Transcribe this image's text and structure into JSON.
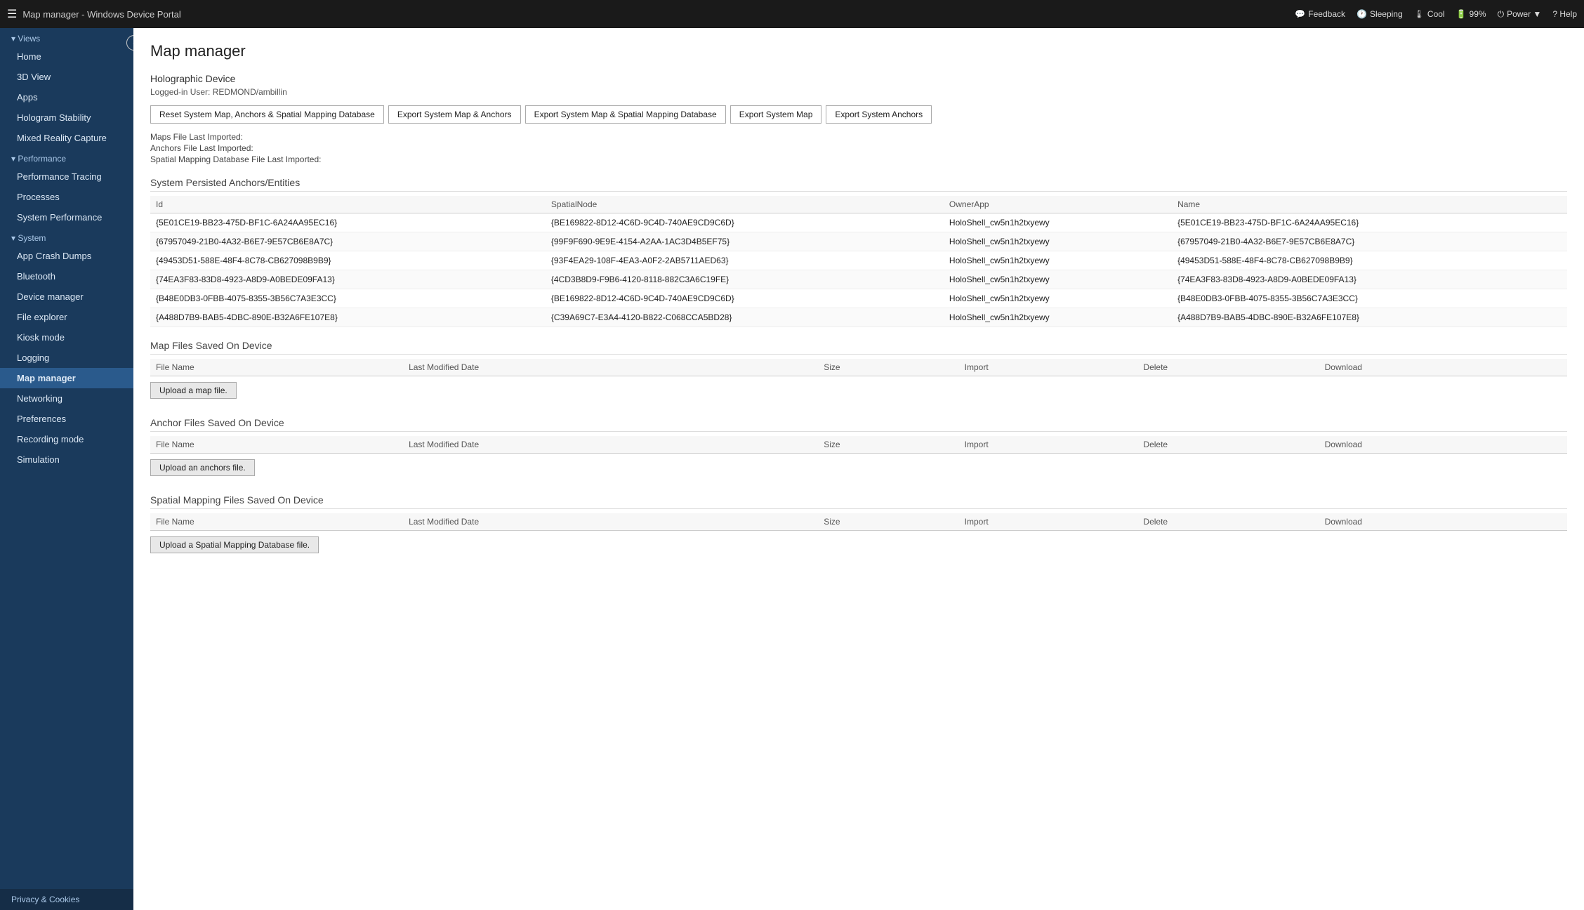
{
  "topbar": {
    "title": "Map manager - Windows Device Portal",
    "hamburger_icon": "☰",
    "items": [
      {
        "label": "Feedback",
        "icon": "💬"
      },
      {
        "label": "Sleeping",
        "icon": "🕐"
      },
      {
        "label": "Cool",
        "icon": "🌡"
      },
      {
        "label": "99%",
        "icon": "🔋"
      },
      {
        "label": "Power ▼",
        "icon": "⏻"
      },
      {
        "label": "? Help",
        "icon": ""
      }
    ]
  },
  "sidebar": {
    "collapse_icon": "‹",
    "sections": [
      {
        "header": "Views",
        "items": [
          "Home",
          "3D View",
          "Apps",
          "Hologram Stability",
          "Mixed Reality Capture"
        ]
      },
      {
        "header": "Performance",
        "items": [
          "Performance Tracing",
          "Processes",
          "System Performance"
        ]
      },
      {
        "header": "System",
        "items": [
          "App Crash Dumps",
          "Bluetooth",
          "Device manager",
          "File explorer",
          "Kiosk mode",
          "Logging",
          "Map manager",
          "Networking",
          "Preferences",
          "Recording mode",
          "Simulation"
        ]
      }
    ],
    "footer": "Privacy & Cookies"
  },
  "page": {
    "title": "Map manager",
    "device": {
      "name": "Holographic Device",
      "user_label": "Logged-in User:",
      "user": "REDMOND/ambillin"
    },
    "buttons": [
      "Reset System Map, Anchors & Spatial Mapping Database",
      "Export System Map & Anchors",
      "Export System Map & Spatial Mapping Database",
      "Export System Map",
      "Export System Anchors"
    ],
    "meta": [
      "Maps File Last Imported:",
      "Anchors File Last Imported:",
      "Spatial Mapping Database File Last Imported:"
    ],
    "anchors_section": {
      "title": "System Persisted Anchors/Entities",
      "columns": [
        "Id",
        "SpatialNode",
        "OwnerApp",
        "Name"
      ],
      "rows": [
        {
          "id": "{5E01CE19-BB23-475D-BF1C-6A24AA95EC16}",
          "spatial_node": "{BE169822-8D12-4C6D-9C4D-740AE9CD9C6D}",
          "owner_app": "HoloShell_cw5n1h2txyewy",
          "name": "{5E01CE19-BB23-475D-BF1C-6A24AA95EC16}"
        },
        {
          "id": "{67957049-21B0-4A32-B6E7-9E57CB6E8A7C}",
          "spatial_node": "{99F9F690-9E9E-4154-A2AA-1AC3D4B5EF75}",
          "owner_app": "HoloShell_cw5n1h2txyewy",
          "name": "{67957049-21B0-4A32-B6E7-9E57CB6E8A7C}"
        },
        {
          "id": "{49453D51-588E-48F4-8C78-CB627098B9B9}",
          "spatial_node": "{93F4EA29-108F-4EA3-A0F2-2AB5711AED63}",
          "owner_app": "HoloShell_cw5n1h2txyewy",
          "name": "{49453D51-588E-48F4-8C78-CB627098B9B9}"
        },
        {
          "id": "{74EA3F83-83D8-4923-A8D9-A0BEDE09FA13}",
          "spatial_node": "{4CD3B8D9-F9B6-4120-8118-882C3A6C19FE}",
          "owner_app": "HoloShell_cw5n1h2txyewy",
          "name": "{74EA3F83-83D8-4923-A8D9-A0BEDE09FA13}"
        },
        {
          "id": "{B48E0DB3-0FBB-4075-8355-3B56C7A3E3CC}",
          "spatial_node": "{BE169822-8D12-4C6D-9C4D-740AE9CD9C6D}",
          "owner_app": "HoloShell_cw5n1h2txyewy",
          "name": "{B48E0DB3-0FBB-4075-8355-3B56C7A3E3CC}"
        },
        {
          "id": "{A488D7B9-BAB5-4DBC-890E-B32A6FE107E8}",
          "spatial_node": "{C39A69C7-E3A4-4120-B822-C068CCA5BD28}",
          "owner_app": "HoloShell_cw5n1h2txyewy",
          "name": "{A488D7B9-BAB5-4DBC-890E-B32A6FE107E8}"
        }
      ]
    },
    "map_files": {
      "title": "Map Files Saved On Device",
      "columns": [
        "File Name",
        "Last Modified Date",
        "Size",
        "Import",
        "Delete",
        "Download"
      ],
      "upload_btn": "Upload a map file."
    },
    "anchor_files": {
      "title": "Anchor Files Saved On Device",
      "columns": [
        "File Name",
        "Last Modified Date",
        "Size",
        "Import",
        "Delete",
        "Download"
      ],
      "upload_btn": "Upload an anchors file."
    },
    "spatial_files": {
      "title": "Spatial Mapping Files Saved On Device",
      "columns": [
        "File Name",
        "Last Modified Date",
        "Size",
        "Import",
        "Delete",
        "Download"
      ],
      "upload_btn": "Upload a Spatial Mapping Database file."
    }
  },
  "privacy": "Privacy & Cookies"
}
